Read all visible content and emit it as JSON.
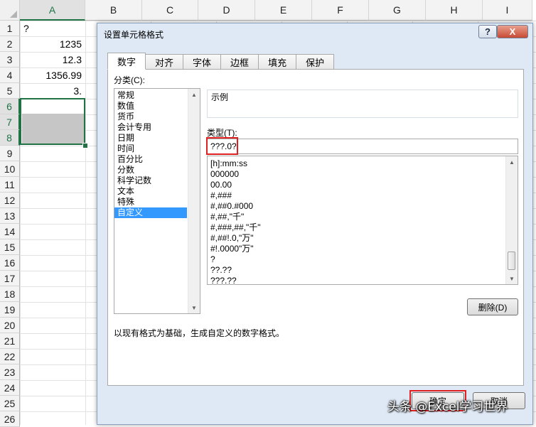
{
  "spreadsheet": {
    "columns": [
      "A",
      "B",
      "C",
      "D",
      "E",
      "F",
      "G",
      "H",
      "I"
    ],
    "rows": [
      "1",
      "2",
      "3",
      "4",
      "5",
      "6",
      "7",
      "8",
      "9",
      "10",
      "11",
      "12",
      "13",
      "14",
      "15",
      "16",
      "17",
      "18",
      "19",
      "20",
      "21",
      "22",
      "23",
      "24",
      "25",
      "26"
    ],
    "cells": [
      {
        "row": "1",
        "value": "?",
        "align": "left"
      },
      {
        "row": "2",
        "value": "1235",
        "align": "right"
      },
      {
        "row": "3",
        "value": "12.3",
        "align": "right"
      },
      {
        "row": "4",
        "value": "1356.99",
        "align": "right"
      },
      {
        "row": "5",
        "value": "3.",
        "align": "right"
      }
    ],
    "selected_column": "A",
    "selected_rows": [
      "6",
      "7",
      "8"
    ],
    "selection_color": "#217346"
  },
  "dialog": {
    "title": "设置单元格格式",
    "help_label": "?",
    "close_label": "X",
    "tabs": [
      {
        "label": "数字",
        "active": true
      },
      {
        "label": "对齐",
        "active": false
      },
      {
        "label": "字体",
        "active": false
      },
      {
        "label": "边框",
        "active": false
      },
      {
        "label": "填充",
        "active": false
      },
      {
        "label": "保护",
        "active": false
      }
    ],
    "category_label": "分类(C):",
    "categories": [
      "常规",
      "数值",
      "货币",
      "会计专用",
      "日期",
      "时间",
      "百分比",
      "分数",
      "科学记数",
      "文本",
      "特殊",
      "自定义"
    ],
    "selected_category": "自定义",
    "sample_label": "示例",
    "type_label": "类型(T):",
    "type_value": "???.0?",
    "format_codes": [
      "[h]:mm:ss",
      "000000",
      "00.00",
      "#,###",
      "#,##0.#000",
      "#,##,\"千\"",
      "#,###,##,\"千\"",
      "#,##!.0,\"万\"",
      "#!.0000\"万\"",
      "?",
      "??.??",
      "???.??"
    ],
    "delete_button": "删除(D)",
    "description": "以现有格式为基础，生成自定义的数字格式。",
    "ok_button": "确定",
    "cancel_button": "取消",
    "highlight_color": "#e02020"
  },
  "watermark": "头条 @Excel学习世界"
}
